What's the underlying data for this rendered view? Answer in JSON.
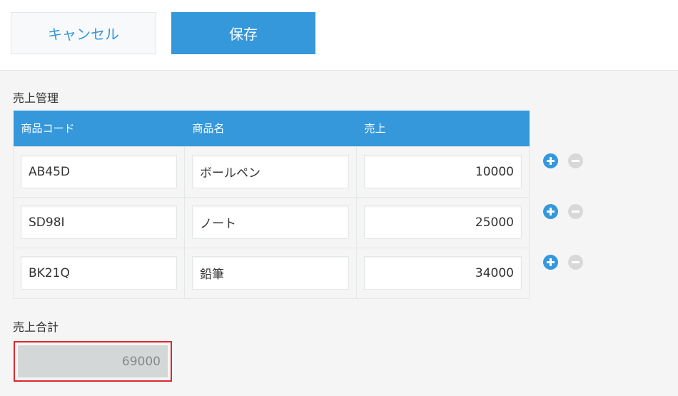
{
  "toolbar": {
    "cancel_label": "キャンセル",
    "save_label": "保存"
  },
  "sales_table": {
    "title": "売上管理",
    "columns": [
      "商品コード",
      "商品名",
      "売上"
    ],
    "rows": [
      {
        "code": "AB45D",
        "name": "ボールペン",
        "sales": "10000"
      },
      {
        "code": "SD98I",
        "name": "ノート",
        "sales": "25000"
      },
      {
        "code": "BK21Q",
        "name": "鉛筆",
        "sales": "34000"
      }
    ],
    "row_actions": {
      "add_icon": "plus-circle-icon",
      "remove_icon": "minus-circle-icon"
    }
  },
  "total": {
    "label": "売上合計",
    "value": "69000"
  },
  "colors": {
    "accent": "#3498db",
    "highlight_border": "#e0272d",
    "disabled_button": "#d8d8d8",
    "readonly_field": "#d4d7d7"
  }
}
